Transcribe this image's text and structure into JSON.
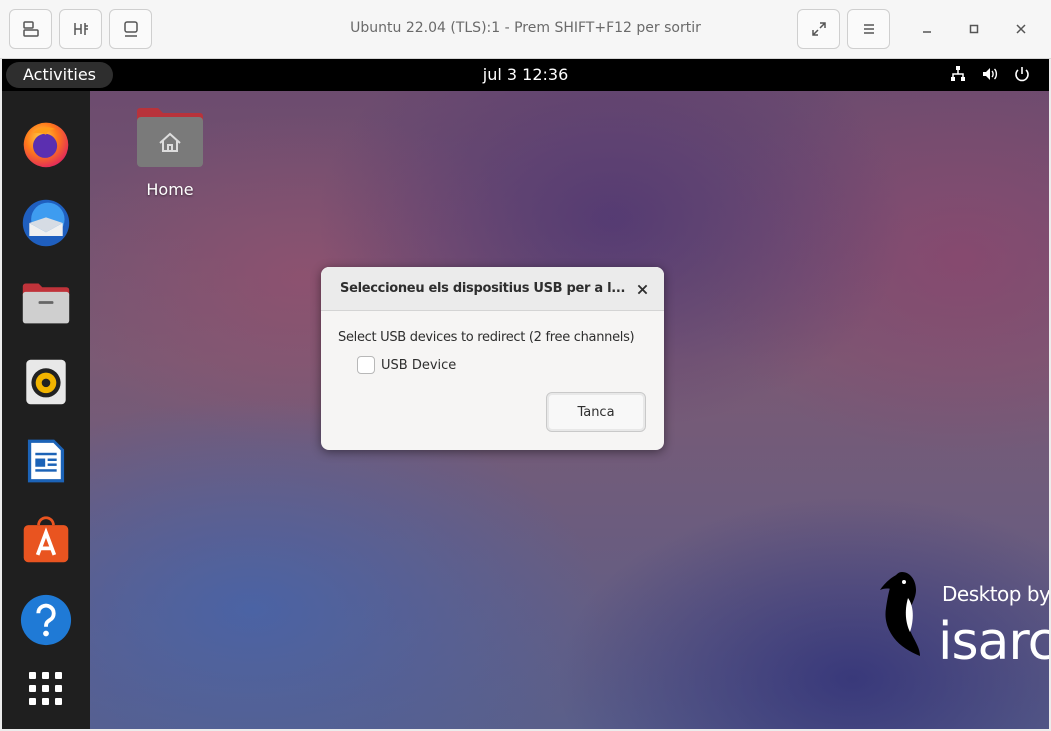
{
  "viewer": {
    "title": "Ubuntu 22.04 (TLS):1 - Prem SHIFT+F12 per sortir",
    "left_buttons": [
      "display-icon",
      "usb-redirect-icon",
      "screen-icon"
    ],
    "right_buttons": [
      "fullscreen-icon",
      "menu-icon"
    ],
    "window_controls": [
      "minimize",
      "maximize",
      "close"
    ]
  },
  "panel": {
    "activities_label": "Activities",
    "clock": "jul 3  12:36",
    "tray_icons": [
      "network-icon",
      "volume-icon",
      "power-icon"
    ]
  },
  "dock": {
    "items": [
      "firefox",
      "thunderbird",
      "files",
      "rhythmbox",
      "libreoffice-writer",
      "ubuntu-software",
      "help",
      "show-apps"
    ]
  },
  "desktop": {
    "icons": [
      {
        "label": "Home",
        "icon": "home-folder-icon"
      }
    ],
    "watermark": {
      "small": "Desktop by",
      "big": "isarc"
    }
  },
  "dialog": {
    "title": "Seleccioneu els dispositius USB per a l...",
    "prompt": "Select USB devices to redirect (2 free channels)",
    "devices": [
      {
        "label": "USB Device",
        "checked": false
      }
    ],
    "close_button_label": "Tanca"
  },
  "colors": {
    "dock_bg": "#1f1f1f",
    "top_panel_bg": "#000000",
    "dialog_bg": "#f6f5f4",
    "ubuntu_orange": "#e95420"
  }
}
